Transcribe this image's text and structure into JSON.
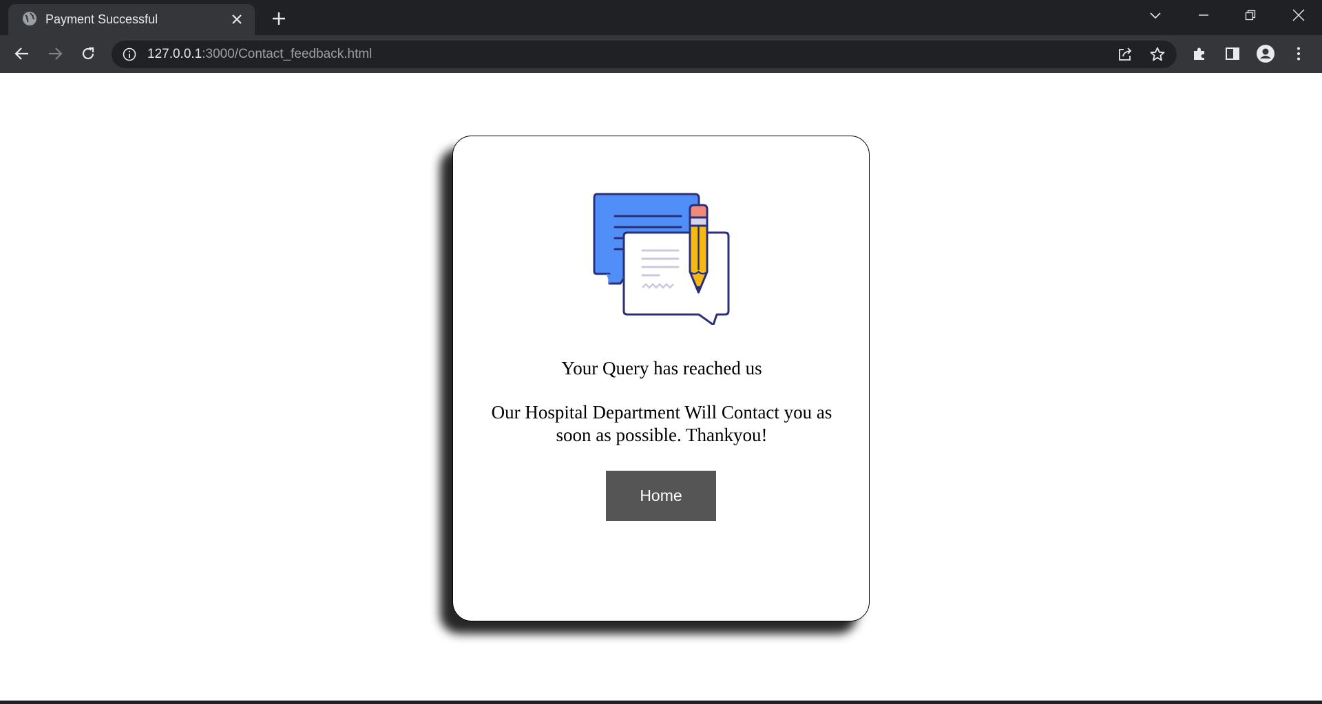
{
  "browser": {
    "tab_title": "Payment Successful",
    "url_host": "127.0.0.1",
    "url_rest": ":3000/Contact_feedback.html",
    "icons": [
      "globe-icon",
      "close-icon",
      "plus-icon",
      "chevron-down-icon",
      "minimize-icon",
      "restore-icon",
      "window-close-icon",
      "back-arrow-icon",
      "forward-arrow-icon",
      "reload-icon",
      "info-icon",
      "share-icon",
      "star-icon",
      "extensions-icon",
      "side-panel-icon",
      "profile-icon",
      "kebab-menu-icon"
    ]
  },
  "card": {
    "heading": "Your Query has reached us",
    "message": "Our Hospital Department Will Contact you as soon as possible. Thankyou!",
    "button_label": "Home",
    "illustration": "feedback-chat-pencil-icon",
    "colors": {
      "bubble_blue": "#4f8ff7",
      "outline_navy": "#2b2f7a",
      "pencil_yellow": "#f5b915",
      "eraser_pink": "#f08a7a",
      "button_bg": "#555555"
    }
  }
}
